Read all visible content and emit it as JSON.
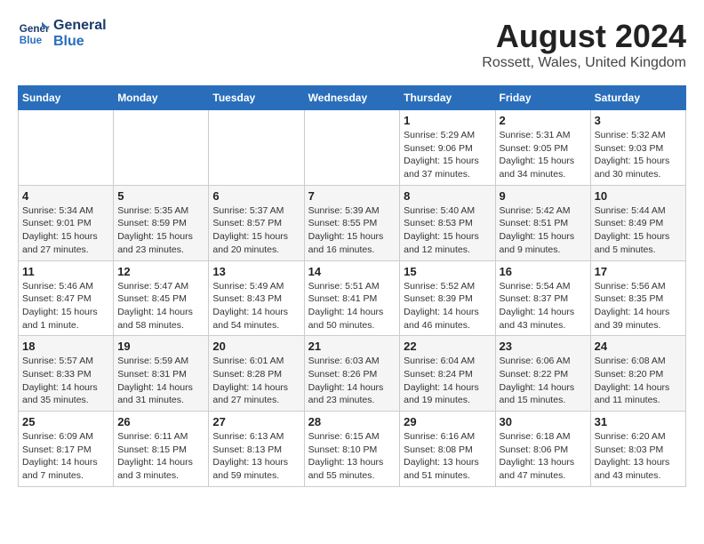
{
  "header": {
    "logo_line1": "General",
    "logo_line2": "Blue",
    "month": "August 2024",
    "location": "Rossett, Wales, United Kingdom"
  },
  "weekdays": [
    "Sunday",
    "Monday",
    "Tuesday",
    "Wednesday",
    "Thursday",
    "Friday",
    "Saturday"
  ],
  "weeks": [
    [
      {
        "day": "",
        "info": ""
      },
      {
        "day": "",
        "info": ""
      },
      {
        "day": "",
        "info": ""
      },
      {
        "day": "",
        "info": ""
      },
      {
        "day": "1",
        "info": "Sunrise: 5:29 AM\nSunset: 9:06 PM\nDaylight: 15 hours\nand 37 minutes."
      },
      {
        "day": "2",
        "info": "Sunrise: 5:31 AM\nSunset: 9:05 PM\nDaylight: 15 hours\nand 34 minutes."
      },
      {
        "day": "3",
        "info": "Sunrise: 5:32 AM\nSunset: 9:03 PM\nDaylight: 15 hours\nand 30 minutes."
      }
    ],
    [
      {
        "day": "4",
        "info": "Sunrise: 5:34 AM\nSunset: 9:01 PM\nDaylight: 15 hours\nand 27 minutes."
      },
      {
        "day": "5",
        "info": "Sunrise: 5:35 AM\nSunset: 8:59 PM\nDaylight: 15 hours\nand 23 minutes."
      },
      {
        "day": "6",
        "info": "Sunrise: 5:37 AM\nSunset: 8:57 PM\nDaylight: 15 hours\nand 20 minutes."
      },
      {
        "day": "7",
        "info": "Sunrise: 5:39 AM\nSunset: 8:55 PM\nDaylight: 15 hours\nand 16 minutes."
      },
      {
        "day": "8",
        "info": "Sunrise: 5:40 AM\nSunset: 8:53 PM\nDaylight: 15 hours\nand 12 minutes."
      },
      {
        "day": "9",
        "info": "Sunrise: 5:42 AM\nSunset: 8:51 PM\nDaylight: 15 hours\nand 9 minutes."
      },
      {
        "day": "10",
        "info": "Sunrise: 5:44 AM\nSunset: 8:49 PM\nDaylight: 15 hours\nand 5 minutes."
      }
    ],
    [
      {
        "day": "11",
        "info": "Sunrise: 5:46 AM\nSunset: 8:47 PM\nDaylight: 15 hours\nand 1 minute."
      },
      {
        "day": "12",
        "info": "Sunrise: 5:47 AM\nSunset: 8:45 PM\nDaylight: 14 hours\nand 58 minutes."
      },
      {
        "day": "13",
        "info": "Sunrise: 5:49 AM\nSunset: 8:43 PM\nDaylight: 14 hours\nand 54 minutes."
      },
      {
        "day": "14",
        "info": "Sunrise: 5:51 AM\nSunset: 8:41 PM\nDaylight: 14 hours\nand 50 minutes."
      },
      {
        "day": "15",
        "info": "Sunrise: 5:52 AM\nSunset: 8:39 PM\nDaylight: 14 hours\nand 46 minutes."
      },
      {
        "day": "16",
        "info": "Sunrise: 5:54 AM\nSunset: 8:37 PM\nDaylight: 14 hours\nand 43 minutes."
      },
      {
        "day": "17",
        "info": "Sunrise: 5:56 AM\nSunset: 8:35 PM\nDaylight: 14 hours\nand 39 minutes."
      }
    ],
    [
      {
        "day": "18",
        "info": "Sunrise: 5:57 AM\nSunset: 8:33 PM\nDaylight: 14 hours\nand 35 minutes."
      },
      {
        "day": "19",
        "info": "Sunrise: 5:59 AM\nSunset: 8:31 PM\nDaylight: 14 hours\nand 31 minutes."
      },
      {
        "day": "20",
        "info": "Sunrise: 6:01 AM\nSunset: 8:28 PM\nDaylight: 14 hours\nand 27 minutes."
      },
      {
        "day": "21",
        "info": "Sunrise: 6:03 AM\nSunset: 8:26 PM\nDaylight: 14 hours\nand 23 minutes."
      },
      {
        "day": "22",
        "info": "Sunrise: 6:04 AM\nSunset: 8:24 PM\nDaylight: 14 hours\nand 19 minutes."
      },
      {
        "day": "23",
        "info": "Sunrise: 6:06 AM\nSunset: 8:22 PM\nDaylight: 14 hours\nand 15 minutes."
      },
      {
        "day": "24",
        "info": "Sunrise: 6:08 AM\nSunset: 8:20 PM\nDaylight: 14 hours\nand 11 minutes."
      }
    ],
    [
      {
        "day": "25",
        "info": "Sunrise: 6:09 AM\nSunset: 8:17 PM\nDaylight: 14 hours\nand 7 minutes."
      },
      {
        "day": "26",
        "info": "Sunrise: 6:11 AM\nSunset: 8:15 PM\nDaylight: 14 hours\nand 3 minutes."
      },
      {
        "day": "27",
        "info": "Sunrise: 6:13 AM\nSunset: 8:13 PM\nDaylight: 13 hours\nand 59 minutes."
      },
      {
        "day": "28",
        "info": "Sunrise: 6:15 AM\nSunset: 8:10 PM\nDaylight: 13 hours\nand 55 minutes."
      },
      {
        "day": "29",
        "info": "Sunrise: 6:16 AM\nSunset: 8:08 PM\nDaylight: 13 hours\nand 51 minutes."
      },
      {
        "day": "30",
        "info": "Sunrise: 6:18 AM\nSunset: 8:06 PM\nDaylight: 13 hours\nand 47 minutes."
      },
      {
        "day": "31",
        "info": "Sunrise: 6:20 AM\nSunset: 8:03 PM\nDaylight: 13 hours\nand 43 minutes."
      }
    ]
  ]
}
